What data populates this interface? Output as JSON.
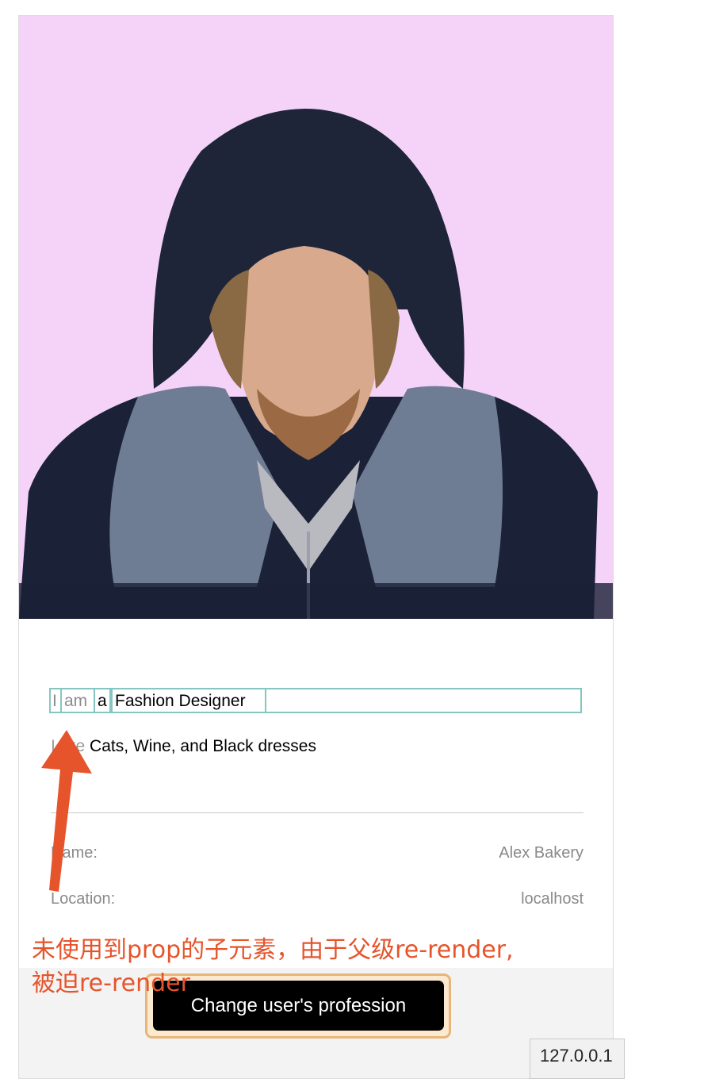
{
  "profile": {
    "photo_alt": "",
    "headline": {
      "seg_i": "I",
      "seg_am": "am",
      "seg_a": "a",
      "profession": "Fashion Designer"
    },
    "tagline": {
      "prefix": "I like",
      "likes": "Cats, Wine, and Black dresses"
    },
    "details": [
      {
        "key": "Name:",
        "value": "Alex Bakery"
      },
      {
        "key": "Location:",
        "value": "localhost"
      }
    ]
  },
  "action": {
    "button_label": "Change user's profession"
  },
  "statusbar": {
    "url": "127.0.0.1"
  },
  "annotation": {
    "line1": "未使用到prop的子元素，由于父级re-render,",
    "line2": "被迫re-render"
  },
  "colors": {
    "photo_bg": "#f5d3f9",
    "highlight_border": "#86c6c2",
    "annotation": "#e6542b",
    "button_bg": "#000000",
    "button_outline": "#e8b57a"
  }
}
